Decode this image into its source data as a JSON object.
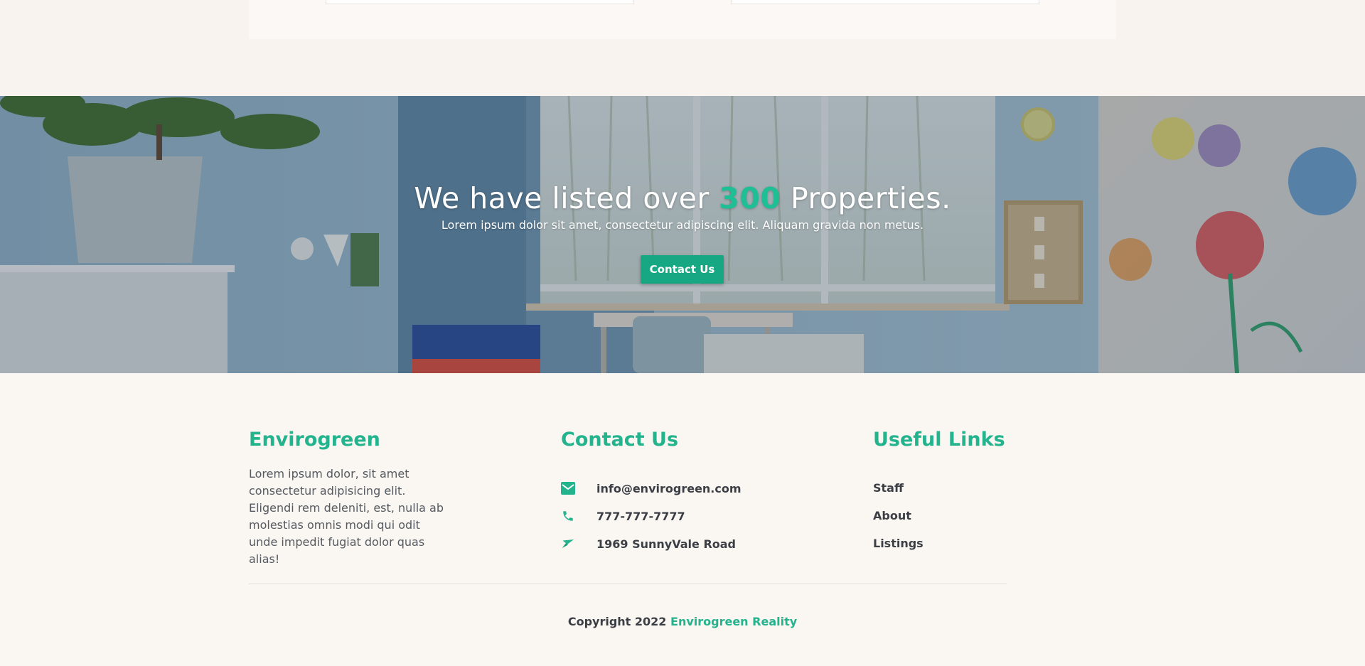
{
  "hero": {
    "title_before": "We have listed over ",
    "title_number": "300",
    "title_after": " Properties.",
    "subtitle": "Lorem ipsum dolor sit amet, consectetur adipiscing elit. Aliquam gravida non metus.",
    "button_label": "Contact Us"
  },
  "footer": {
    "about": {
      "title": "Envirogreen",
      "text": "Lorem ipsum dolor, sit amet consectetur adipisicing elit. Eligendi rem deleniti, est, nulla ab molestias omnis modi qui odit unde impedit fugiat dolor quas alias!"
    },
    "contact": {
      "title": "Contact Us",
      "items": [
        {
          "icon": "mail-icon",
          "text": "info@envirogreen.com"
        },
        {
          "icon": "phone-icon",
          "text": "777-777-7777"
        },
        {
          "icon": "send-icon",
          "text": "1969 SunnyVale Road"
        }
      ]
    },
    "links": {
      "title": "Useful Links",
      "items": [
        "Staff",
        "About",
        "Listings"
      ]
    },
    "copyright": {
      "prefix": "Copyright 2022",
      "brand": "Envirogreen Reality"
    }
  },
  "colors": {
    "accent": "#23b38d",
    "button": "#17a883",
    "background": "#faf6f2",
    "text": "#3b3f45"
  }
}
